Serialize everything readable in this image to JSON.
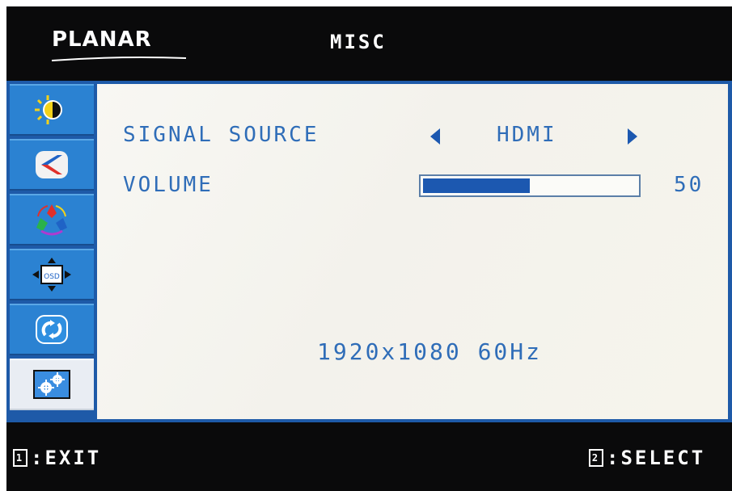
{
  "header": {
    "brand": "PLANAR",
    "title": "MISC"
  },
  "sidebar": {
    "items": [
      {
        "icon": "brightness-contrast-icon",
        "active": false
      },
      {
        "icon": "image-adjust-icon",
        "active": false
      },
      {
        "icon": "color-icon",
        "active": false
      },
      {
        "icon": "osd-position-icon",
        "active": false
      },
      {
        "icon": "reset-icon",
        "active": false
      },
      {
        "icon": "misc-settings-icon",
        "active": true
      }
    ]
  },
  "main": {
    "signal_source": {
      "label": "SIGNAL SOURCE",
      "value": "HDMI"
    },
    "volume": {
      "label": "VOLUME",
      "value": "50",
      "level_fraction": 0.5
    },
    "resolution": "1920x1080 60Hz"
  },
  "footer": {
    "exit_key": "1",
    "exit_label": ":EXIT",
    "select_key": "2",
    "select_label": ":SELECT"
  },
  "colors": {
    "accent_blue": "#2f6db8",
    "frame_blue": "#1e5aa8",
    "background_dark": "#0a0a0b",
    "panel_bg": "#f5f4ee"
  }
}
